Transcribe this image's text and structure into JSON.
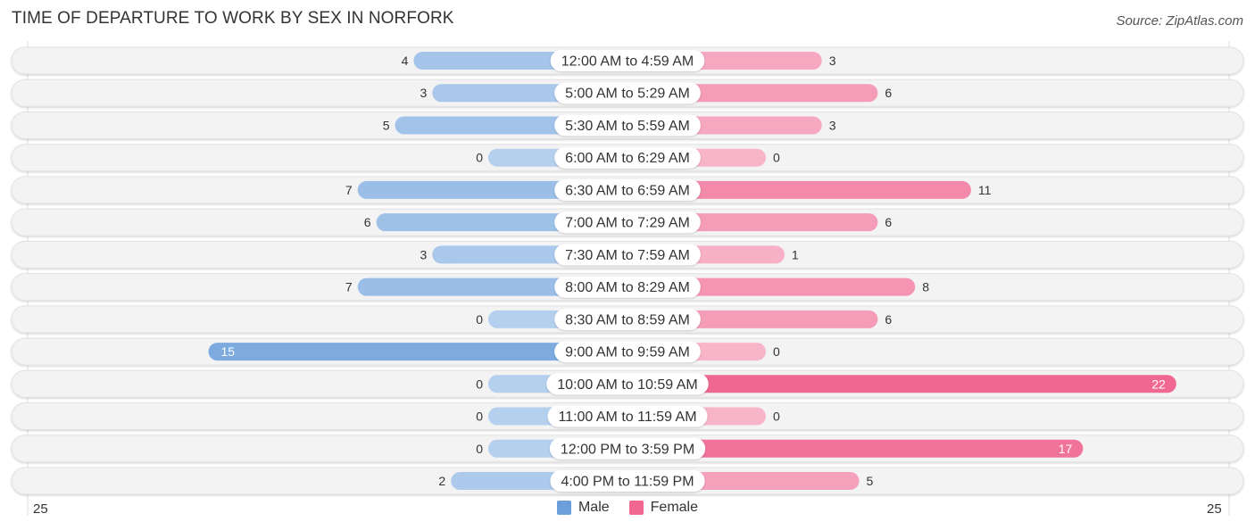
{
  "title": "TIME OF DEPARTURE TO WORK BY SEX IN NORFORK",
  "source": "Source: ZipAtlas.com",
  "legend": [
    {
      "label": "Male",
      "color": "#6a9fdc"
    },
    {
      "label": "Female",
      "color": "#f06892"
    }
  ],
  "axis": {
    "left_label": "25",
    "right_label": "25"
  },
  "chart_data": {
    "type": "bar",
    "orientation": "horizontal-diverging",
    "title": "TIME OF DEPARTURE TO WORK BY SEX IN NORFORK",
    "categories": [
      "12:00 AM to 4:59 AM",
      "5:00 AM to 5:29 AM",
      "5:30 AM to 5:59 AM",
      "6:00 AM to 6:29 AM",
      "6:30 AM to 6:59 AM",
      "7:00 AM to 7:29 AM",
      "7:30 AM to 7:59 AM",
      "8:00 AM to 8:29 AM",
      "8:30 AM to 8:59 AM",
      "9:00 AM to 9:59 AM",
      "10:00 AM to 10:59 AM",
      "11:00 AM to 11:59 AM",
      "12:00 PM to 3:59 PM",
      "4:00 PM to 11:59 PM"
    ],
    "series": [
      {
        "name": "Male",
        "color": "#6a9fdc",
        "side": "left",
        "values": [
          4,
          3,
          5,
          0,
          7,
          6,
          3,
          7,
          0,
          15,
          0,
          0,
          0,
          2
        ]
      },
      {
        "name": "Female",
        "color": "#f06892",
        "side": "right",
        "values": [
          3,
          6,
          3,
          0,
          11,
          6,
          1,
          8,
          6,
          0,
          22,
          0,
          17,
          5
        ]
      }
    ],
    "xlim": [
      -25,
      25
    ],
    "tick_labels": [
      "25",
      "25"
    ],
    "legend_position": "bottom-center",
    "grid": false,
    "xlabel": "",
    "ylabel": ""
  }
}
